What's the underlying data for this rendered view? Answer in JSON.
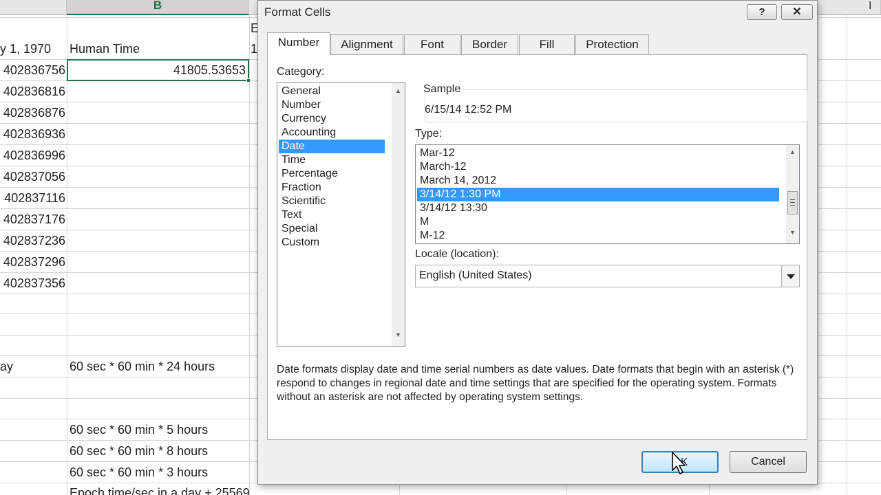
{
  "sheet": {
    "column_b_header": "B",
    "header_row": {
      "a": "y 1, 1970",
      "b": "Human Time"
    },
    "c_fragments": [
      "E",
      "1"
    ],
    "active_cell_value": "41805.53653",
    "column_a_values": [
      "402836756",
      "402836816",
      "402836876",
      "402836936",
      "402836996",
      "402837056",
      "402837116",
      "402837176",
      "402837236",
      "402837296",
      "402837356"
    ],
    "row_day": {
      "a": "ay",
      "b": "60 sec * 60 min * 24 hours"
    },
    "row_5h": "60 sec * 60 min * 5 hours",
    "row_8h": "60 sec * 60 min * 8 hours",
    "row_3h": "60 sec * 60 min * 3 hours",
    "row_epoch": "Epoch time/sec in a day + 25569",
    "cursor_glyph": "I"
  },
  "dialog": {
    "title": "Format Cells",
    "help_label": "?",
    "close_label": "✕",
    "tabs": [
      "Number",
      "Alignment",
      "Font",
      "Border",
      "Fill",
      "Protection"
    ],
    "active_tab": "Number",
    "category_label": "Category:",
    "categories": [
      "General",
      "Number",
      "Currency",
      "Accounting",
      "Date",
      "Time",
      "Percentage",
      "Fraction",
      "Scientific",
      "Text",
      "Special",
      "Custom"
    ],
    "selected_category": "Date",
    "sample_label": "Sample",
    "sample_value": "6/15/14 12:52 PM",
    "type_label": "Type:",
    "types": [
      "Mar-12",
      "March-12",
      "March 14, 2012",
      "3/14/12 1:30 PM",
      "3/14/12 13:30",
      "M",
      "M-12"
    ],
    "selected_type": "3/14/12 1:30 PM",
    "locale_label": "Locale (location):",
    "locale_value": "English (United States)",
    "description": "Date formats display date and time serial numbers as date values.  Date formats that begin with an asterisk (*) respond to changes in regional date and time settings that are specified for the operating system. Formats without an asterisk are not affected by operating system settings.",
    "ok_label": "OK",
    "cancel_label": "Cancel"
  },
  "icons": {
    "scroll_up": "up-arrow-icon",
    "scroll_down": "down-arrow-icon",
    "dropdown": "chevron-down-icon",
    "pointer": "mouse-pointer-icon"
  },
  "colors": {
    "selection": "#3399ff",
    "excel_green": "#217346",
    "ok_border": "#3c7fb1"
  }
}
